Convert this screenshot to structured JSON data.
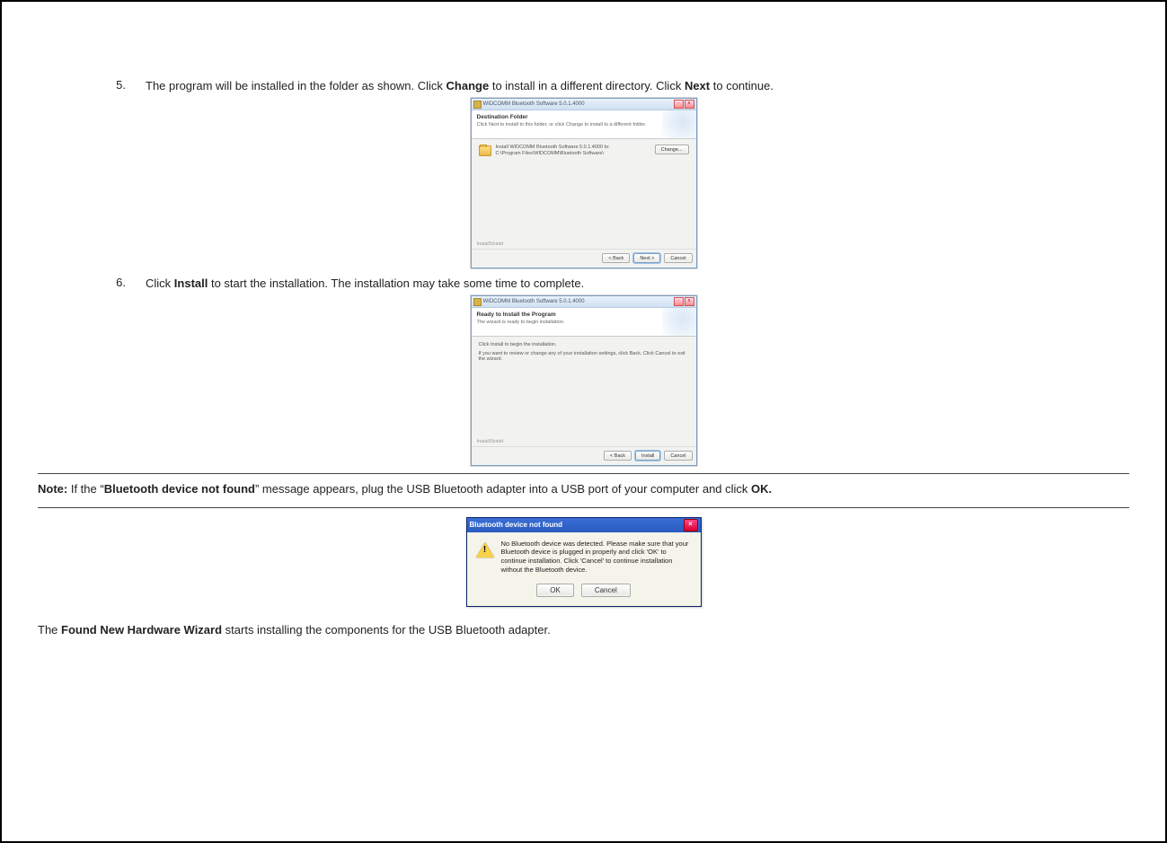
{
  "steps": {
    "s5_num": "5.",
    "s5_a": "The program will be installed in the folder as shown. Click ",
    "s5_b": "Change",
    "s5_c": " to install in a different directory. Click ",
    "s5_d": "Next",
    "s5_e": " to continue.",
    "s6_num": "6.",
    "s6_a": "Click ",
    "s6_b": "Install",
    "s6_c": " to start the installation. The installation may take some time to complete."
  },
  "dlg1": {
    "title": "WIDCOMM Bluetooth Software 5.0.1.4000",
    "header_title": "Destination Folder",
    "header_sub": "Click Next to install to this folder, or click Change to install to a different folder.",
    "line1": "Install WIDCOMM Bluetooth Software 5.0.1.4000 to:",
    "line2": "C:\\Program Files\\WIDCOMM\\Bluetooth Software\\",
    "change": "Change...",
    "status": "InstallShield",
    "back": "< Back",
    "next": "Next >",
    "cancel": "Cancel"
  },
  "dlg2": {
    "title": "WIDCOMM Bluetooth Software 5.0.1.4000",
    "header_title": "Ready to Install the Program",
    "header_sub": "The wizard is ready to begin installation.",
    "body1": "Click Install to begin the installation.",
    "body2": "If you want to review or change any of your installation settings, click Back. Click Cancel to exit the wizard.",
    "status": "InstallShield",
    "back": "< Back",
    "install": "Install",
    "cancel": "Cancel"
  },
  "note": {
    "a": "Note:",
    "b": " If the “",
    "c": "Bluetooth device not found",
    "d": "” message appears, plug the USB Bluetooth adapter into a USB port of your computer and click ",
    "e": "OK."
  },
  "alert": {
    "title": "Bluetooth device not found",
    "msg": "No Bluetooth device was detected. Please make sure that your Bluetooth device is plugged in properly and click 'OK' to continue installation. Click 'Cancel' to continue installation without the Bluetooth device.",
    "ok": "OK",
    "cancel": "Cancel"
  },
  "final": {
    "a": "The ",
    "b": "Found New Hardware Wizard",
    "c": " starts installing the components for the USB Bluetooth adapter."
  }
}
